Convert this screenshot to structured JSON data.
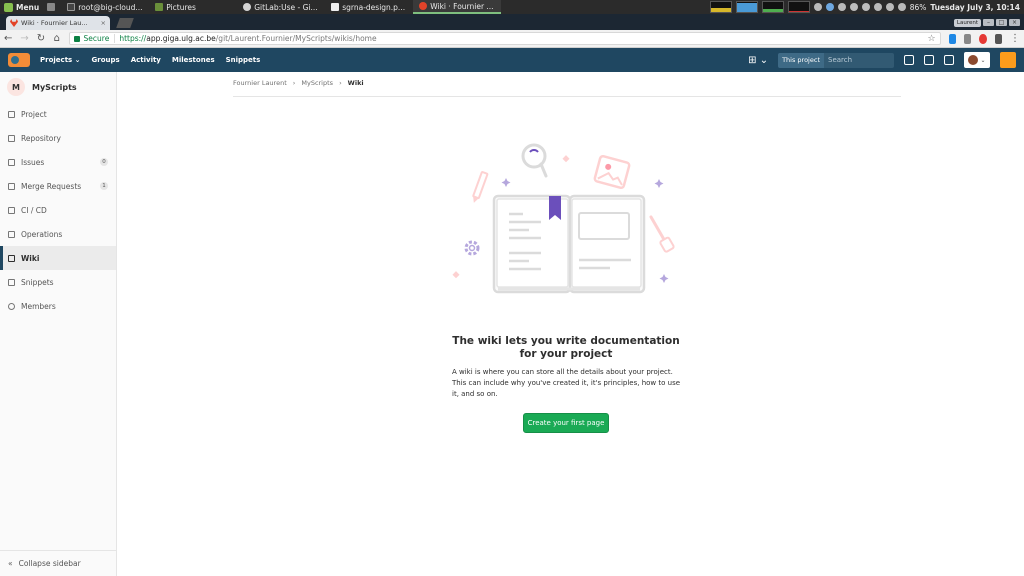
{
  "taskbar": {
    "menu_label": "Menu",
    "tasks": [
      {
        "label": "root@big-cloud...",
        "color": "#444"
      },
      {
        "label": "Pictures",
        "color": "#6a8f3a"
      },
      {
        "label": "GitLab:Use - Gi...",
        "color": "#d5d5d5"
      },
      {
        "label": "sgrna-design.p...",
        "color": "#eee"
      },
      {
        "label": "Wiki · Fournier ...",
        "color": "#e24329"
      }
    ],
    "battery": "86%",
    "clock": "Tuesday July  3, 10:14"
  },
  "browser": {
    "tab_title": "Wiki · Fournier Lau...",
    "tab_close": "×",
    "user_label": "Laurent",
    "secure_label": "Secure",
    "url_scheme": "https://",
    "url_host": "app.giga.ulg.ac.be",
    "url_path": "/git/Laurent.Fournier/MyScripts/wikis/home"
  },
  "header": {
    "nav": [
      "Projects",
      "Groups",
      "Activity",
      "Milestones",
      "Snippets"
    ],
    "projects_caret": "⌄",
    "search_scope": "This project",
    "search_placeholder": "Search"
  },
  "sidebar": {
    "project_initial": "M",
    "project_name": "MyScripts",
    "items": [
      {
        "label": "Project"
      },
      {
        "label": "Repository"
      },
      {
        "label": "Issues",
        "badge": "0"
      },
      {
        "label": "Merge Requests",
        "badge": "1"
      },
      {
        "label": "CI / CD"
      },
      {
        "label": "Operations"
      },
      {
        "label": "Wiki",
        "active": true
      },
      {
        "label": "Snippets"
      },
      {
        "label": "Members"
      }
    ],
    "collapse_label": "Collapse sidebar"
  },
  "breadcrumb": {
    "items": [
      "Fournier Laurent",
      "MyScripts",
      "Wiki"
    ],
    "separator": "›"
  },
  "empty_state": {
    "title": "The wiki lets you write documentation for your project",
    "text": "A wiki is where you can store all the details about your project. This can include why you've created it, it's principles, how to use it, and so on.",
    "button": "Create your first page"
  },
  "colors": {
    "header_bg": "#1f4761",
    "primary_button": "#1aaa55",
    "illustration_accent": "#6b4fbb",
    "illustration_pink": "#fc9aa8"
  }
}
